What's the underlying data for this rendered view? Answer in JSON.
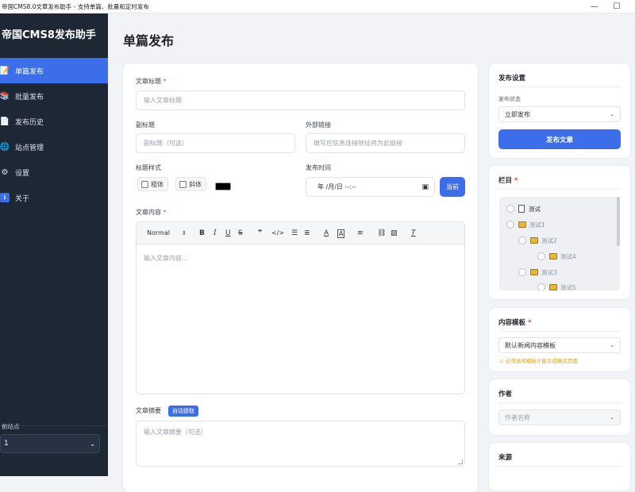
{
  "window": {
    "title": "帝国CMS8.0文章发布助手 - 支持单篇、批量和定时发布",
    "minimize": "—",
    "maximize": "☐"
  },
  "sidebar": {
    "brand": "帝国CMS8发布助手",
    "items": [
      {
        "label": "单篇发布",
        "icon": "📝"
      },
      {
        "label": "批量发布",
        "icon": "📚"
      },
      {
        "label": "发布历史",
        "icon": "📄"
      },
      {
        "label": "站点管理",
        "icon": "🌐"
      },
      {
        "label": "设置",
        "icon": "⚙"
      },
      {
        "label": "关于",
        "icon": "ℹ"
      }
    ],
    "current_site_label": "前站点",
    "current_site_value": "1"
  },
  "page": {
    "title": "单篇发布"
  },
  "form": {
    "title_label": "文章标题",
    "title_placeholder": "输入文章标题",
    "subtitle_label": "副标题",
    "subtitle_placeholder": "副标题（可选）",
    "link_label": "外部链接",
    "link_placeholder": "填写后信息连接地址将为此链接",
    "style_label": "标题样式",
    "bold_label": "粗体",
    "italic_label": "斜体",
    "time_label": "发布时间",
    "time_value": "年 /月/日 --:--",
    "now_button": "当前",
    "content_label": "文章内容",
    "content_placeholder": "输入文章内容...",
    "format_select": "Normal",
    "summary_label": "文章摘要",
    "auto_extract": "自动提取",
    "summary_placeholder": "输入文章摘要（可选）"
  },
  "publish": {
    "title": "发布设置",
    "status_label": "发布状态",
    "status_value": "立即发布",
    "button": "发布文章"
  },
  "column": {
    "title": "栏目",
    "items": [
      "测试",
      "测试1",
      "测试2",
      "测试4",
      "测试3",
      "测试5"
    ]
  },
  "template": {
    "title": "内容模板",
    "value": "默认新闻内容模板",
    "warning": "必须选择模板才能生成静态页面"
  },
  "author": {
    "title": "作者",
    "placeholder": "作者名称"
  },
  "source": {
    "title": "来源"
  },
  "colors": {
    "accent": "#3b6ee8",
    "sidebar": "#1e2734"
  }
}
